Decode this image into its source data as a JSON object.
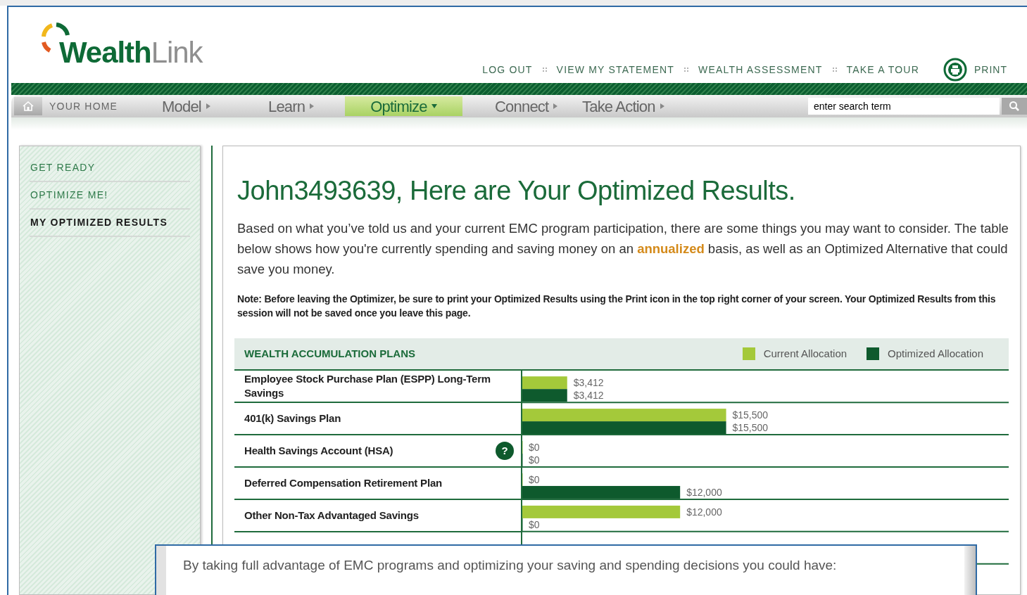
{
  "logo": {
    "primary": "Wealth",
    "secondary": "Link"
  },
  "top_links": [
    "LOG OUT",
    "VIEW MY STATEMENT",
    "WEALTH ASSESSMENT",
    "TAKE A TOUR"
  ],
  "print_label": "PRINT",
  "nav": [
    {
      "label": "YOUR HOME",
      "kind": "home",
      "selected": false
    },
    {
      "label": "Model",
      "kind": "menu",
      "selected": false
    },
    {
      "label": "Learn",
      "kind": "menu",
      "selected": false
    },
    {
      "label": "Optimize",
      "kind": "menu",
      "selected": true
    },
    {
      "label": "Connect",
      "kind": "menu",
      "selected": false
    },
    {
      "label": "Take Action",
      "kind": "menu",
      "selected": false
    }
  ],
  "search": {
    "placeholder": "enter search term"
  },
  "sidebar": {
    "items": [
      {
        "label": "GET READY",
        "selected": false
      },
      {
        "label": "OPTIMIZE ME!",
        "selected": false
      },
      {
        "label": "MY OPTIMIZED RESULTS",
        "selected": true
      }
    ]
  },
  "heading": "John3493639, Here are Your Optimized Results.",
  "intro": "Based on what you’ve told us and your current EMC program participation, there are some things you may want to consider. The table below shows how you're currently spending and saving money on an **annualized** basis, as well as an Optimized Alternative that could save you money.",
  "note": "Note: Before leaving the Optimizer, be sure to print your Optimized Results using the Print icon in the top right corner of your screen. Your Optimized Results from this session will not be saved once you leave this page.",
  "plans": {
    "title": "WEALTH ACCUMULATION PLANS",
    "help_text": "?",
    "rows": [
      {
        "help": false
      },
      {
        "help": false
      },
      {
        "help": true
      },
      {
        "help": false
      },
      {
        "help": false
      }
    ],
    "chart_data": {
      "type": "bar",
      "orientation": "horizontal",
      "categories": [
        "Employee Stock Purchase Plan (ESPP) Long-Term Savings",
        "401(k) Savings Plan",
        "Health Savings Account (HSA)",
        "Deferred Compensation Retirement Plan",
        "Other Non-Tax Advantaged Savings"
      ],
      "series": [
        {
          "name": "Current Allocation",
          "color": "#a4c93a",
          "values": [
            3412,
            15500,
            0,
            0,
            12000
          ],
          "value_labels": [
            "$3,412",
            "$15,500",
            "$0",
            "$0",
            "$12,000"
          ]
        },
        {
          "name": "Optimized Allocation",
          "color": "#0e5a2d",
          "values": [
            3412,
            15500,
            0,
            12000,
            0
          ],
          "value_labels": [
            "$3,412",
            "$15,500",
            "$0",
            "$12,000",
            "$0"
          ]
        }
      ]
    }
  },
  "popup": {
    "text": "By taking full advantage of EMC programs and optimizing your saving and spending decisions you could have:"
  }
}
